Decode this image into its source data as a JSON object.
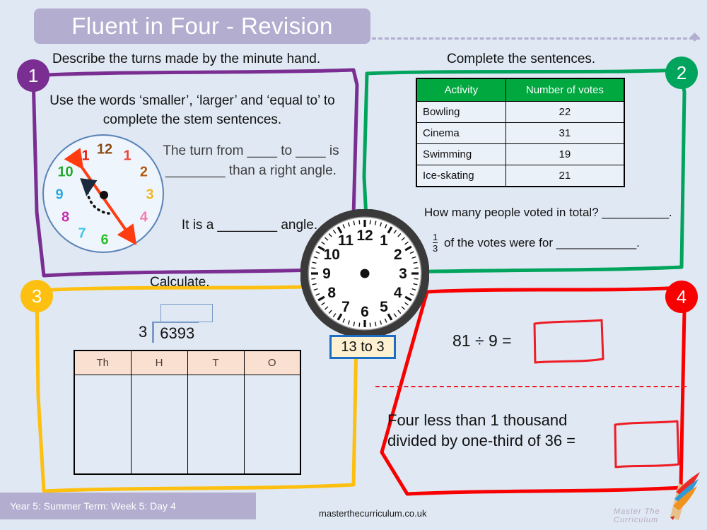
{
  "header": {
    "title": "Fluent in Four - Revision"
  },
  "sections": [
    {
      "number": "1",
      "color": "#7a2e92",
      "heading": "Describe the turns made by the minute hand.",
      "instruction": "Use the words ‘smaller’, ‘larger’ and ‘equal to’ to complete the stem sentences.",
      "stem_1": "The turn from ____ to ____ is ________ than a right angle.",
      "stem_2": "It is a ________ angle.",
      "clock": {
        "numerals": [
          "1",
          "2",
          "3",
          "4",
          "5",
          "6",
          "7",
          "8",
          "9",
          "10",
          "11",
          "12"
        ],
        "numeral_colors": [
          "#e8463c",
          "#b05a10",
          "#f0b429",
          "#f07ab0",
          "#f0920f",
          "#2bbf2b",
          "#3fc4e8",
          "#c42bb0",
          "#29a8e0",
          "#1fa82b",
          "#e8200f",
          "#8a4a16"
        ],
        "arrow_from": "11",
        "arrow_to": "5",
        "arrow_color": "#ff3b10"
      }
    },
    {
      "number": "2",
      "color": "#00a45c",
      "heading": "Complete the sentences.",
      "table": {
        "headers": [
          "Activity",
          "Number of votes"
        ],
        "rows": [
          [
            "Bowling",
            "22"
          ],
          [
            "Cinema",
            "31"
          ],
          [
            "Swimming",
            "19"
          ],
          [
            "Ice-skating",
            "21"
          ]
        ]
      },
      "total_question": "How many people voted in total? __________.",
      "fraction_numerator": "1",
      "fraction_denominator": "3",
      "fraction_question": "of the votes were for ____________."
    },
    {
      "number": "3",
      "color": "#fdc010",
      "heading": "Calculate.",
      "division": {
        "divisor": "3",
        "dividend": "6393",
        "answer": ""
      },
      "place_value_headers": [
        "Th",
        "H",
        "T",
        "O"
      ]
    },
    {
      "number": "4",
      "color": "#f90000",
      "sum_1": "81 ÷ 9 =",
      "sum_1_answer": "",
      "sum_2": "Four less than 1 thousand divided by one-third of 36 =",
      "sum_2_answer": ""
    }
  ],
  "center_clock": {
    "numerals": [
      "1",
      "2",
      "3",
      "4",
      "5",
      "6",
      "7",
      "8",
      "9",
      "10",
      "11",
      "12"
    ],
    "label": "13 to 3"
  },
  "footer": {
    "lesson": "Year 5: Summer Term: Week 5: Day 4",
    "url": "masterthecurriculum.co.uk",
    "brand": "Master The Curriculum"
  }
}
